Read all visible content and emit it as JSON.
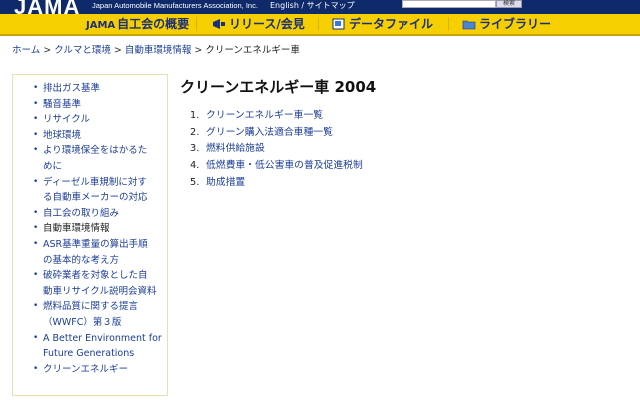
{
  "header": {
    "logo": "JAMA",
    "org": "Japan Automobile Manufacturers Association, Inc.",
    "toplinks": "English / サイトマップ",
    "search_button": "検索"
  },
  "nav": {
    "items": [
      {
        "label": "自工会の概要",
        "brand": "JAMA",
        "icon": "jama-logo-icon"
      },
      {
        "label": "リリース/会見",
        "icon": "megaphone-icon"
      },
      {
        "label": "データファイル",
        "icon": "document-icon"
      },
      {
        "label": "ライブラリー",
        "icon": "folder-icon"
      }
    ]
  },
  "breadcrumb": {
    "items": [
      "ホーム",
      "クルマと環境",
      "自動車環境情報"
    ],
    "current": "クリーンエネルギー車",
    "separator": ">"
  },
  "sidebar": {
    "items": [
      {
        "label": "排出ガス基準",
        "link": true
      },
      {
        "label": "騒音基準",
        "link": true
      },
      {
        "label": "リサイクル",
        "link": true
      },
      {
        "label": "地球環境",
        "link": true
      },
      {
        "label": "より環境保全をはかるた\nめに",
        "link": true
      },
      {
        "label": "ディーゼル車規制に対す\nる自動車メーカーの対応",
        "link": true
      },
      {
        "label": "自工会の取り組み",
        "link": true
      },
      {
        "label": "自動車環境情報",
        "link": false
      },
      {
        "label": "ASR基準重量の算出手順\nの基本的な考え方",
        "link": true
      },
      {
        "label": "破砕業者を対象とした自\n動車リサイクル説明会資料",
        "link": true
      },
      {
        "label": "燃料品質に関する提言\n（WWFC）第３版",
        "link": true
      },
      {
        "label": "A Better Environment for\nFuture Generations",
        "link": true
      },
      {
        "label": "クリーンエネルギー",
        "link": true
      }
    ]
  },
  "main": {
    "title": "クリーンエネルギー車 2004",
    "items": [
      {
        "num": "1.",
        "label": "クリーンエネルギー車一覧"
      },
      {
        "num": "2.",
        "label": "グリーン購入法適合車種一覧"
      },
      {
        "num": "3.",
        "label": "燃料供給施設"
      },
      {
        "num": "4.",
        "label": "低燃費車・低公害車の普及促進税制"
      },
      {
        "num": "5.",
        "label": "助成措置"
      }
    ]
  },
  "colors": {
    "header_bg": "#0f2a6b",
    "nav_bg": "#f6cf00",
    "link": "#1d3e96"
  }
}
